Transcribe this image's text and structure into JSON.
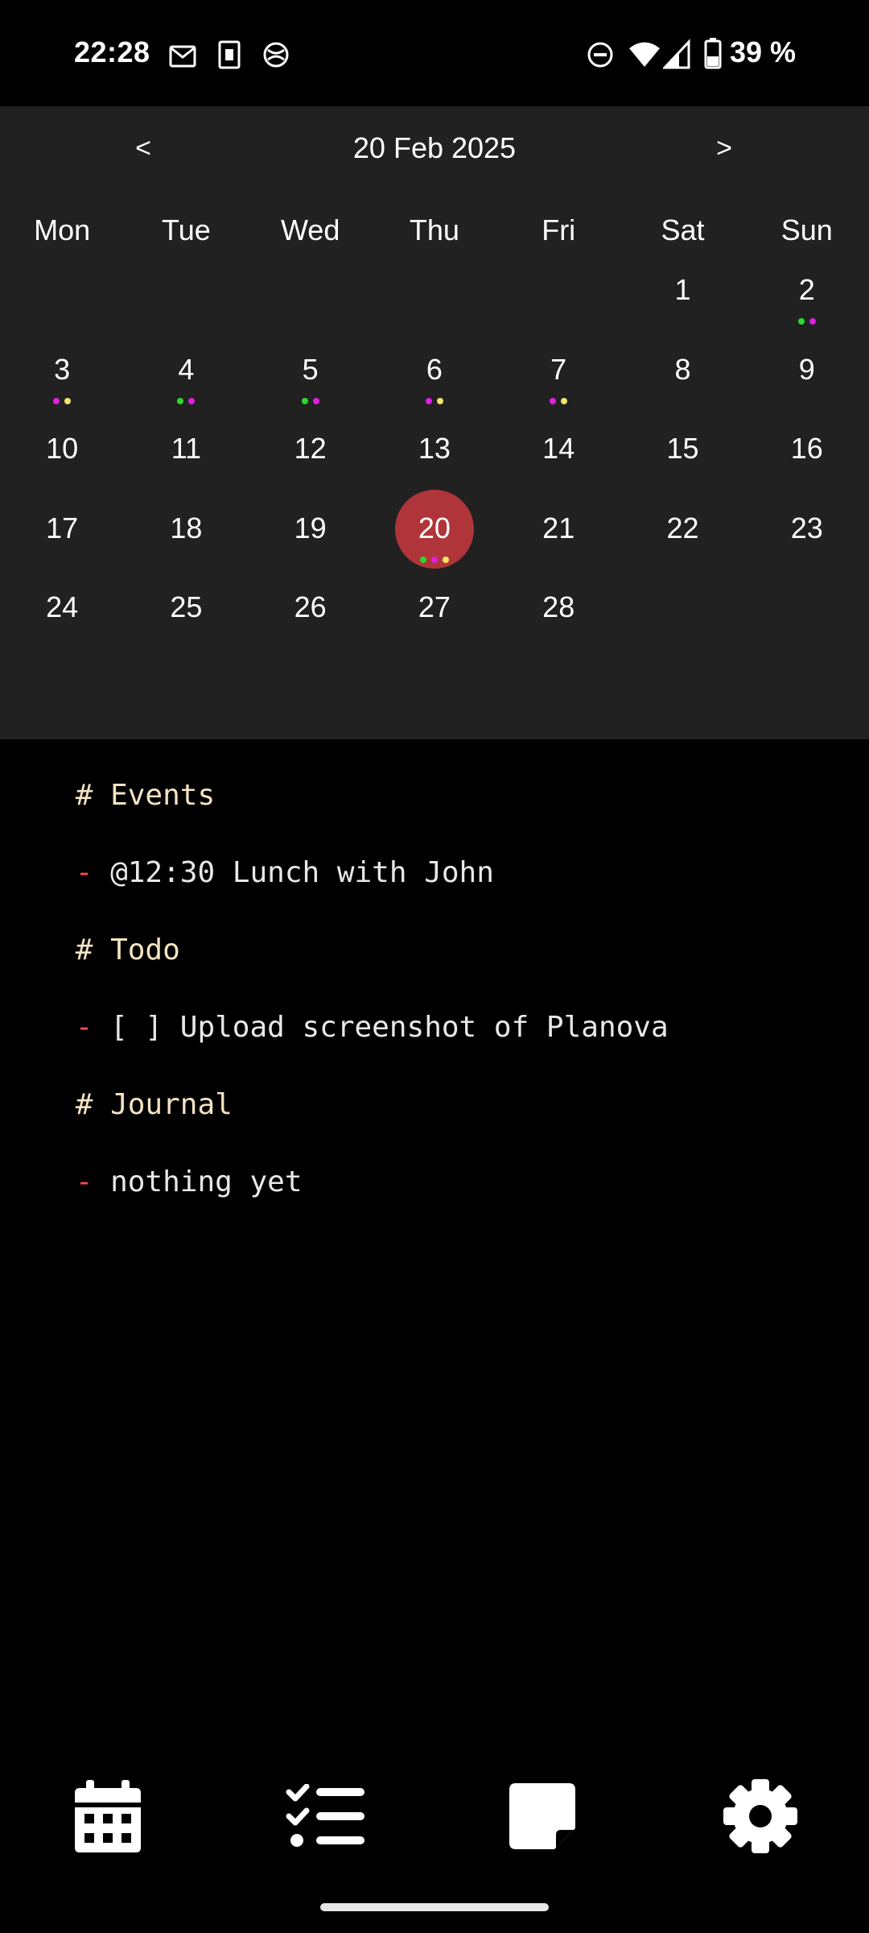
{
  "status_bar": {
    "time": "22:28",
    "left_icons": [
      "mail-icon",
      "sim-card-icon",
      "sync-icon"
    ],
    "right_icons": [
      "do-not-disturb-icon",
      "wifi-icon",
      "cellular-signal-icon",
      "battery-icon"
    ],
    "battery": "39 %"
  },
  "calendar": {
    "prev_label": "<",
    "next_label": ">",
    "title": "20 Feb 2025",
    "weekdays": [
      "Mon",
      "Tue",
      "Wed",
      "Thu",
      "Fri",
      "Sat",
      "Sun"
    ],
    "selected_day": 20,
    "selected_color": "#b0353a",
    "dot_colors": {
      "green": "#2ed82e",
      "magenta": "#e01fe0",
      "yellow": "#f5e46a"
    },
    "weeks": [
      [
        null,
        null,
        null,
        null,
        null,
        {
          "day": 1
        },
        {
          "day": 2,
          "dots": [
            "green",
            "magenta"
          ]
        }
      ],
      [
        {
          "day": 3,
          "dots": [
            "magenta",
            "yellow"
          ]
        },
        {
          "day": 4,
          "dots": [
            "green",
            "magenta"
          ]
        },
        {
          "day": 5,
          "dots": [
            "green",
            "magenta"
          ]
        },
        {
          "day": 6,
          "dots": [
            "magenta",
            "yellow"
          ]
        },
        {
          "day": 7,
          "dots": [
            "magenta",
            "yellow"
          ]
        },
        {
          "day": 8
        },
        {
          "day": 9
        }
      ],
      [
        {
          "day": 10
        },
        {
          "day": 11
        },
        {
          "day": 12
        },
        {
          "day": 13
        },
        {
          "day": 14
        },
        {
          "day": 15
        },
        {
          "day": 16
        }
      ],
      [
        {
          "day": 17
        },
        {
          "day": 18
        },
        {
          "day": 19
        },
        {
          "day": 20,
          "dots": [
            "green",
            "magenta",
            "yellow"
          ]
        },
        {
          "day": 21
        },
        {
          "day": 22
        },
        {
          "day": 23
        }
      ],
      [
        {
          "day": 24
        },
        {
          "day": 25
        },
        {
          "day": 26
        },
        {
          "day": 27
        },
        {
          "day": 28
        },
        null,
        null
      ]
    ]
  },
  "notes": {
    "events_heading": "Events",
    "event_item": "@12:30 Lunch with John",
    "todo_heading": "Todo",
    "todo_item": "[ ] Upload screenshot of Planova",
    "journal_heading": "Journal",
    "journal_item": "nothing yet",
    "hash": "#",
    "dash": "-"
  },
  "bottom_nav": {
    "items": [
      "calendar-icon",
      "checklist-icon",
      "note-icon",
      "settings-icon"
    ]
  }
}
